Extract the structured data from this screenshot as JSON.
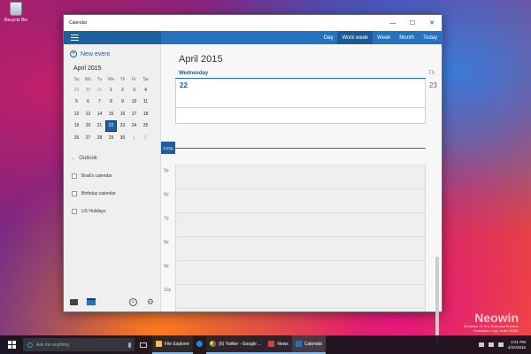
{
  "desktop": {
    "recycle_bin_label": "Recycle Bin",
    "watermark": {
      "brand": "Neowin",
      "lines": [
        "Windows 10 Pro Technical Preview",
        "Evaluation copy. Build 10061"
      ]
    }
  },
  "window": {
    "title": "Calendar",
    "controls": {
      "minimize": "—",
      "maximize": "☐",
      "close": "✕"
    }
  },
  "header": {
    "views": [
      {
        "label": "Day",
        "active": false
      },
      {
        "label": "Work week",
        "active": true
      },
      {
        "label": "Week",
        "active": false
      },
      {
        "label": "Month",
        "active": false
      },
      {
        "label": "Today",
        "active": false
      }
    ]
  },
  "sidebar": {
    "new_event_label": "New event",
    "mini_calendar": {
      "title": "April 2015",
      "weekdays": [
        "Su",
        "Mo",
        "Tu",
        "We",
        "Th",
        "Fr",
        "Sa"
      ],
      "weeks": [
        [
          "29",
          "30",
          "31",
          "1",
          "2",
          "3",
          "4"
        ],
        [
          "5",
          "6",
          "7",
          "8",
          "9",
          "10",
          "11"
        ],
        [
          "12",
          "13",
          "14",
          "15",
          "16",
          "17",
          "18"
        ],
        [
          "19",
          "20",
          "21",
          "22",
          "23",
          "24",
          "25"
        ],
        [
          "26",
          "27",
          "28",
          "29",
          "30",
          "1",
          "2"
        ]
      ],
      "today": "22"
    },
    "account_label": "Outlook",
    "calendars": [
      {
        "label": "Brad's calendar"
      },
      {
        "label": "Birthday calendar"
      },
      {
        "label": "US Holidays"
      }
    ]
  },
  "main": {
    "month_title": "April 2015",
    "day_header": "Wednesday",
    "day_number": "22",
    "next_day_header": "Th",
    "next_day_number": "23",
    "now_label": "4:21p",
    "hours": [
      "5p",
      "6p",
      "7p",
      "8p",
      "9p",
      "10p",
      "11p"
    ]
  },
  "taskbar": {
    "search_placeholder": "Ask me anything",
    "apps": [
      {
        "label": "File Explorer",
        "icon": "folder-icon",
        "state": "running"
      },
      {
        "label": "",
        "icon": "ie-icon",
        "state": "pinned"
      },
      {
        "label": "(6) Twitter - Google ...",
        "icon": "chrome-icon",
        "state": "running"
      },
      {
        "label": "News",
        "icon": "news-icon",
        "state": "running"
      },
      {
        "label": "Calendar",
        "icon": "calendar-app-icon",
        "state": "active"
      }
    ],
    "clock_time": "4:21 PM",
    "clock_date": "4/22/2015"
  }
}
